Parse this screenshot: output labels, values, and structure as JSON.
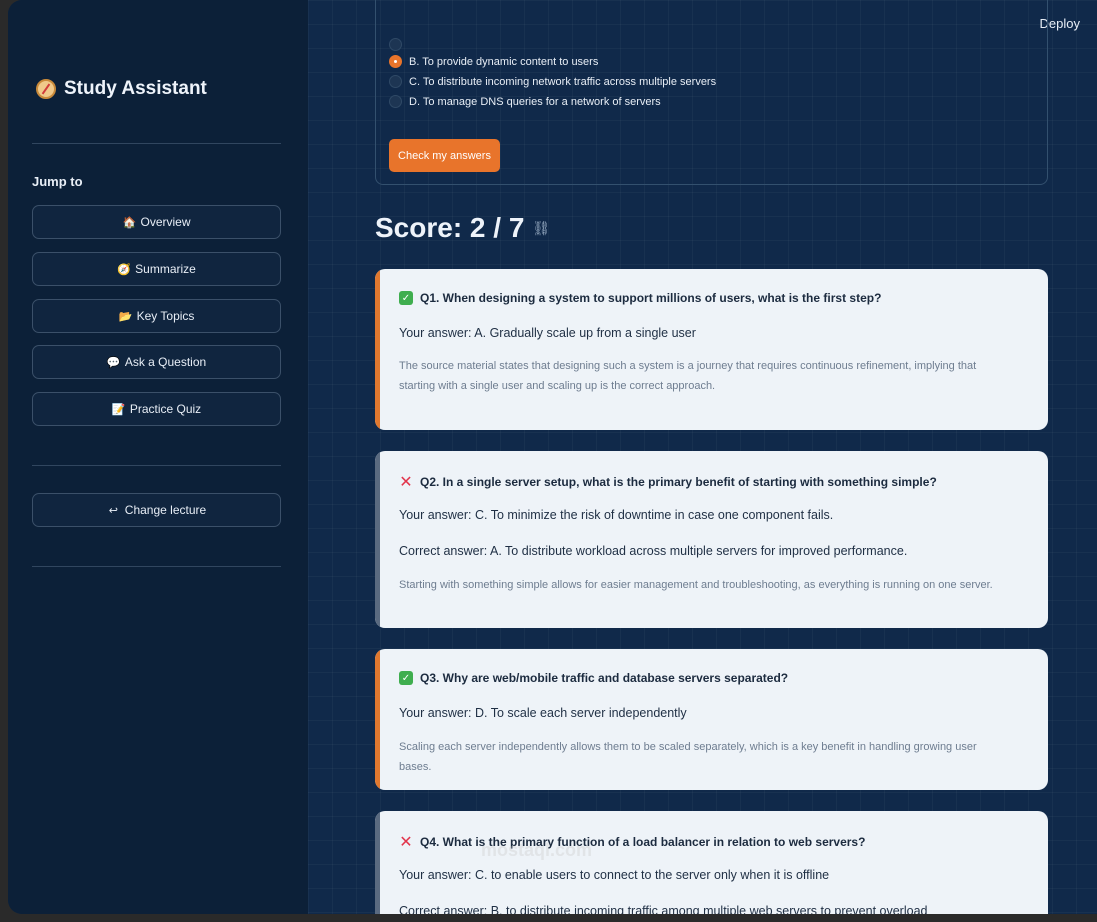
{
  "app": {
    "title": "Study Assistant",
    "icon": "compass-icon"
  },
  "sidebar": {
    "jump_label": "Jump to",
    "items": [
      {
        "label": "Overview",
        "icon": "house-icon",
        "glyph": "🏠"
      },
      {
        "label": "Summarize",
        "icon": "compass-icon",
        "glyph": "🧭"
      },
      {
        "label": "Key Topics",
        "icon": "folder-icon",
        "glyph": "📂"
      },
      {
        "label": "Ask a Question",
        "icon": "speech-bubble-icon",
        "glyph": "💬"
      },
      {
        "label": "Practice Quiz",
        "icon": "memo-icon",
        "glyph": "📝"
      }
    ],
    "change_lecture": {
      "label": "Change lecture",
      "icon": "return-arrow-icon",
      "glyph": "↩"
    }
  },
  "header": {
    "deploy_label": "Deploy"
  },
  "quiz": {
    "options": [
      {
        "label": "B. To provide dynamic content to users",
        "selected": true
      },
      {
        "label": "C. To distribute incoming network traffic across multiple servers",
        "selected": false
      },
      {
        "label": "D. To manage DNS queries for a network of servers",
        "selected": false
      }
    ],
    "check_label": "Check my answers"
  },
  "score": {
    "label": "Score: 2 / 7"
  },
  "results": [
    {
      "correct": true,
      "title": "Q1. When designing a system to support millions of users, what is the first step?",
      "your_answer": "Your answer: A. Gradually scale up from a single user",
      "correct_answer": "",
      "explanation": "The source material states that designing such a system is a journey that requires continuous refinement, implying that starting with a single user and scaling up is the correct approach."
    },
    {
      "correct": false,
      "title": "Q2. In a single server setup, what is the primary benefit of starting with something simple?",
      "your_answer": "Your answer: C. To minimize the risk of downtime in case one component fails.",
      "correct_answer": "Correct answer: A. To distribute workload across multiple servers for improved performance.",
      "explanation": "Starting with something simple allows for easier management and troubleshooting, as everything is running on one server."
    },
    {
      "correct": true,
      "title": "Q3. Why are web/mobile traffic and database servers separated?",
      "your_answer": "Your answer: D. To scale each server independently",
      "correct_answer": "",
      "explanation": "Scaling each server independently allows them to be scaled separately, which is a key benefit in handling growing user bases."
    },
    {
      "correct": false,
      "title": "Q4. What is the primary function of a load balancer in relation to web servers?",
      "your_answer": "Your answer: C. to enable users to connect to the server only when it is offline",
      "correct_answer": "Correct answer: B. to distribute incoming traffic among multiple web servers to prevent overload",
      "explanation": ""
    }
  ],
  "watermark": "mostaql.com",
  "colors": {
    "accent": "#e8742b",
    "sidebar_bg": "#0c2038",
    "main_bg": "#10294a",
    "card_bg": "#eef3f8",
    "correct_mark": "#3fae4f",
    "wrong_mark": "#e2344c"
  }
}
